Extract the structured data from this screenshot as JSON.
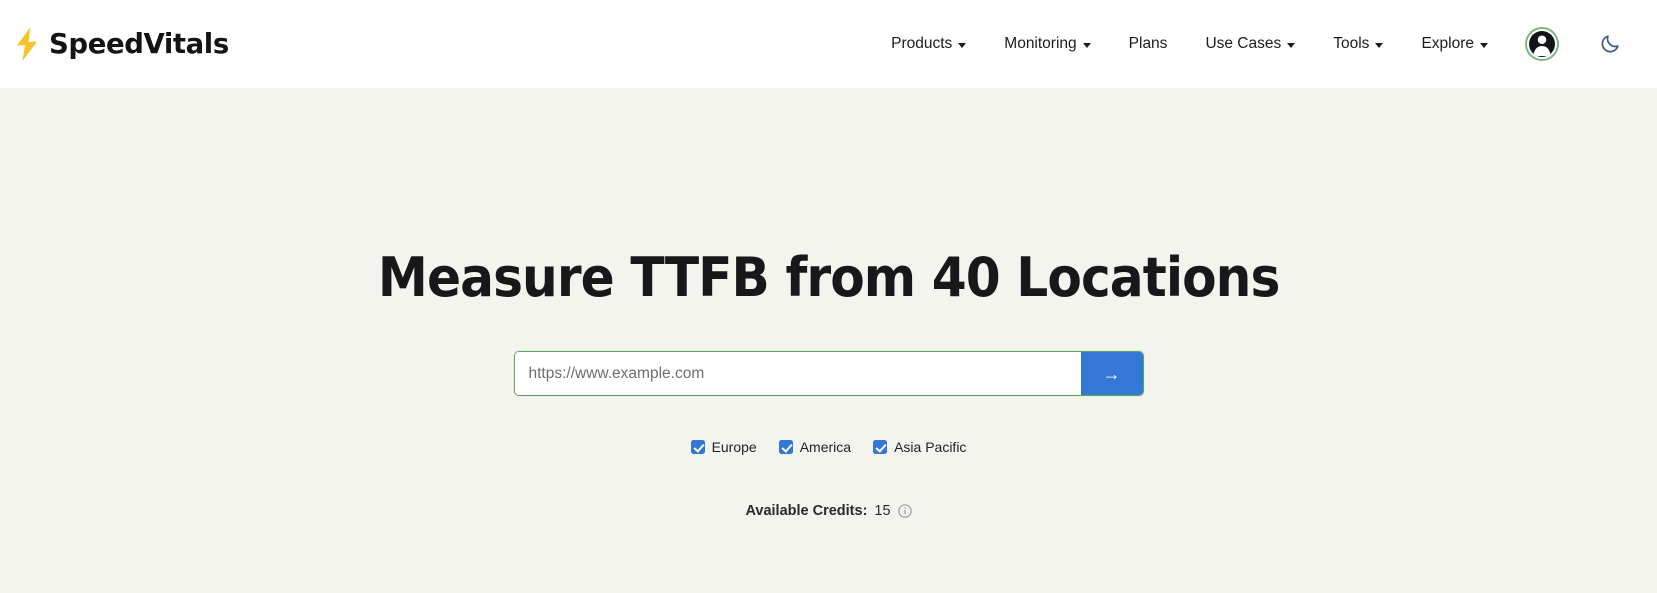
{
  "brand": {
    "name": "SpeedVitals",
    "logo_icon": "lightning-bolt-icon",
    "logo_color": "#f9c22b"
  },
  "header": {
    "background": "#ffffff",
    "nav_items": [
      {
        "label": "Products",
        "has_dropdown": true
      },
      {
        "label": "Monitoring",
        "has_dropdown": true
      },
      {
        "label": "Plans",
        "has_dropdown": false
      },
      {
        "label": "Use Cases",
        "has_dropdown": true
      },
      {
        "label": "Tools",
        "has_dropdown": true
      },
      {
        "label": "Explore",
        "has_dropdown": true
      }
    ],
    "account": {
      "icon": "user-avatar-icon",
      "ring_color": "#7cb87f"
    },
    "theme_toggle": {
      "icon": "moon-icon",
      "color": "#3f5d86"
    }
  },
  "main": {
    "background": "#f4f4ef",
    "title": "Measure TTFB from 40 Locations",
    "search": {
      "placeholder": "https://www.example.com",
      "value": "",
      "border_color": "#5aa65e",
      "submit_label": "→",
      "submit_icon": "arrow-right-icon",
      "submit_color": "#3278d4"
    },
    "regions": [
      {
        "label": "Europe",
        "checked": true
      },
      {
        "label": "America",
        "checked": true
      },
      {
        "label": "Asia Pacific",
        "checked": true
      }
    ],
    "credits": {
      "label": "Available Credits:",
      "value": "15",
      "info_icon": "info-circle-icon"
    }
  }
}
